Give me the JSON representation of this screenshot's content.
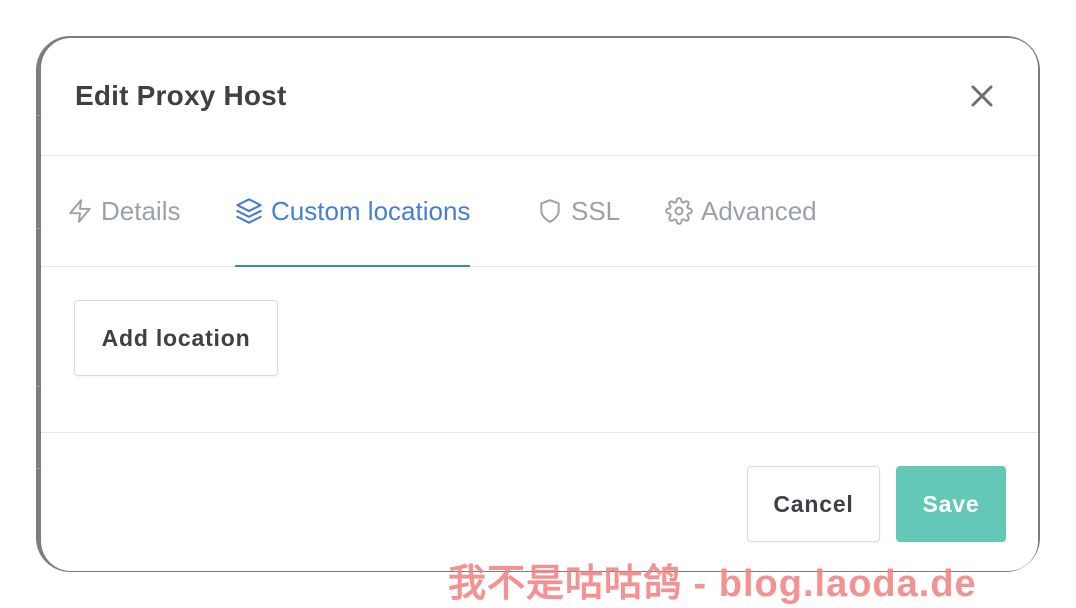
{
  "dialog": {
    "title": "Edit Proxy Host",
    "close_icon": "close-icon"
  },
  "tabs": [
    {
      "label": "Details",
      "icon": "bolt-icon",
      "active": false
    },
    {
      "label": "Custom locations",
      "icon": "layers-icon",
      "active": true
    },
    {
      "label": "SSL",
      "icon": "shield-icon",
      "active": false
    },
    {
      "label": "Advanced",
      "icon": "gear-icon",
      "active": false
    }
  ],
  "locations": {
    "add_label": "Add location"
  },
  "footer": {
    "cancel_label": "Cancel",
    "save_label": "Save"
  },
  "watermark": {
    "text": "我不是咕咕鸽 - blog.laoda.de"
  },
  "colors": {
    "accent": "#467fcf",
    "save": "#63c8b6",
    "inactive_tab": "#9aa0ac",
    "title": "#3d4146",
    "watermark": "#f07f7f"
  }
}
